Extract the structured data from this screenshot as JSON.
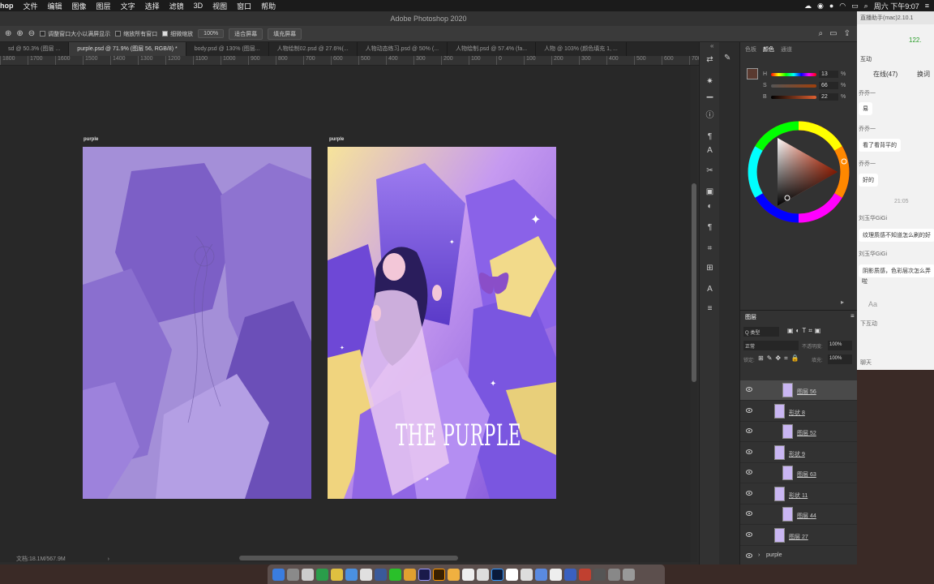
{
  "menubar": {
    "app": "hop",
    "items": [
      "文件",
      "编辑",
      "图像",
      "图层",
      "文字",
      "选择",
      "滤镜",
      "3D",
      "视图",
      "窗口",
      "帮助"
    ],
    "clock": "周六 下午9:07"
  },
  "window": {
    "title": "Adobe Photoshop 2020"
  },
  "options": {
    "resize_windows": "调整窗口大小以满屏显示",
    "zoom_all": "缩放所有窗口",
    "scrubby_zoom": "细微缩放",
    "zoom_value": "100%",
    "fit_screen": "适合屏幕",
    "fill_screen": "填充屏幕"
  },
  "tabs": [
    "sd @ 50.3% (图层 ...",
    "purple.psd @ 71.9% (图层 56, RGB/8) *",
    "body.psd @ 130% (图层...",
    "人物绘制02.psd @ 27.6%(...",
    "人物动态练习.psd @ 50% (...",
    "人物绘制.psd @ 57.4% (fa...",
    "人物 @ 103% (颜色填充 1, ..."
  ],
  "ruler": [
    "1800",
    "1700",
    "1600",
    "1500",
    "1400",
    "1300",
    "1200",
    "1100",
    "1000",
    "900",
    "800",
    "700",
    "600",
    "500",
    "400",
    "300",
    "200",
    "100",
    "0",
    "100",
    "200",
    "300",
    "400",
    "500",
    "600",
    "700",
    "800",
    "900",
    "1000",
    "1100",
    "1200",
    "1300",
    "1400",
    "1500",
    "1600",
    "1700"
  ],
  "artboards": {
    "left_label": "purple",
    "right_label": "purple",
    "title_text": "THE PURPLE"
  },
  "status": {
    "doc_size": "文档:18.1M/567.9M",
    "arrow": "›"
  },
  "colorpanel": {
    "tabs": [
      "色板",
      "颜色",
      "通道"
    ],
    "h_label": "H",
    "h_value": "13",
    "s_label": "S",
    "s_value": "66",
    "b_label": "B",
    "b_value": "22",
    "pct": "%",
    "fg_color": "#5a3a30",
    "bg_color": "#e8c8c0"
  },
  "layerspanel": {
    "title": "图层",
    "filter": "Q 类型",
    "blend": "正常",
    "opacity_label": "不透明度:",
    "opacity": "100%",
    "lock_label": "锁定:",
    "fill_label": "填充:",
    "fill": "100%",
    "layers": [
      {
        "name": "图层 56",
        "selected": true,
        "clip": true
      },
      {
        "name": "形状 8",
        "selected": false,
        "clip": false
      },
      {
        "name": "图层 52",
        "selected": false,
        "clip": true
      },
      {
        "name": "形状 9",
        "selected": false,
        "clip": false
      },
      {
        "name": "图层 63",
        "selected": false,
        "clip": true
      },
      {
        "name": "形状 11",
        "selected": false,
        "clip": false
      },
      {
        "name": "图层 44",
        "selected": false,
        "clip": true
      },
      {
        "name": "图层 27",
        "selected": false,
        "clip": false
      }
    ],
    "group": "purple"
  },
  "chat": {
    "title": "直播助手(mac)2.10.1",
    "signal": "122.",
    "tab_online": "在线(47)",
    "tab_invite": "换词",
    "interact": "互动",
    "msgs": [
      "乔乔一",
      "易",
      "乔乔一",
      "看了看背平的",
      "乔乔一",
      "好的",
      "21:05",
      "刘玉华GiGi",
      "纹理质感不知道怎么刷的好",
      "刘玉华GiGi",
      "阴影质感，色彩层次怎么弄",
      "啦"
    ],
    "input_hint": "Aa",
    "footer": "下互动",
    "footer2": "聊天"
  }
}
